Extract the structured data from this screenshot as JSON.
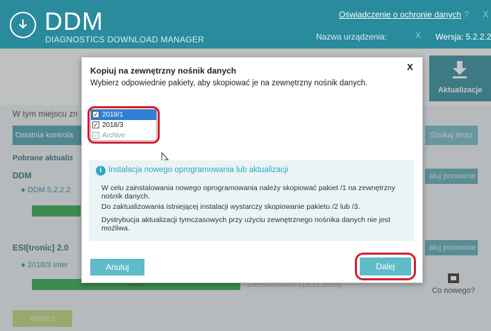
{
  "app": {
    "title": "DDM",
    "subtitle": "DIAGNOSTICS DOWNLOAD MANAGER",
    "privacy_link": "Oświadczenie o ochronie danych",
    "help": "?",
    "close": "X",
    "device_label": "Nazwa urządzenia:",
    "device_clear": "X",
    "version_label": "Wersja: 5.2.2.2"
  },
  "main": {
    "update_button": "Aktualizacje",
    "location_label": "W tym miejscu zn",
    "last_check_label": "Ostatnia kontrola",
    "search_now": "Szukaj teraz",
    "downloaded_label": "Pobrane aktualiz",
    "sections": [
      {
        "name": "DDM",
        "item": "DDM 5.2.2.2",
        "reinstall": "aluj ponownie"
      },
      {
        "name": "ESI[tronic] 2.0",
        "item": "2018/3 Inter",
        "reinstall": "aluj ponownie",
        "progress": "100%",
        "status": "Zainstalowano (19.11.2018)"
      }
    ],
    "whats_new": "Co nowego?",
    "back": "Wstecz"
  },
  "dialog": {
    "title": "Kopiuj na zewnętrzny nośnik danych",
    "close": "X",
    "subtitle": "Wybierz odpowiednie pakiety, aby skopiować je na zewnętrzny nośnik danych.",
    "packages": [
      {
        "label": "2018/1",
        "checked": true,
        "selected": true,
        "disabled": false
      },
      {
        "label": "2018/3",
        "checked": true,
        "selected": false,
        "disabled": false
      },
      {
        "label": "Archive",
        "checked": true,
        "selected": false,
        "disabled": true
      }
    ],
    "info": {
      "icon": "info-icon",
      "heading": "Instalacja nowego oprogramowania lub aktualizacji",
      "p1": "W celu zainstalowania nowego oprogramowania należy skopiować pakiet /1 na zewnętrzny nośnik danych.",
      "p2": "Do zaktualizowania istniejącej instalacji wystarczy skopiowanie pakietu /2 lub /3.",
      "p3": "Dystrybucja aktualizacji tymczasowych przy użyciu zewnętrznego nośnika danych nie jest możliwa."
    },
    "cancel": "Anuluj",
    "next": "Dalej"
  },
  "colors": {
    "header": "#2a8b9c",
    "accent": "#5fbbc8",
    "highlight_ring": "#d2202e",
    "selected_row": "#2f7fd4",
    "progress": "#2da84a"
  }
}
